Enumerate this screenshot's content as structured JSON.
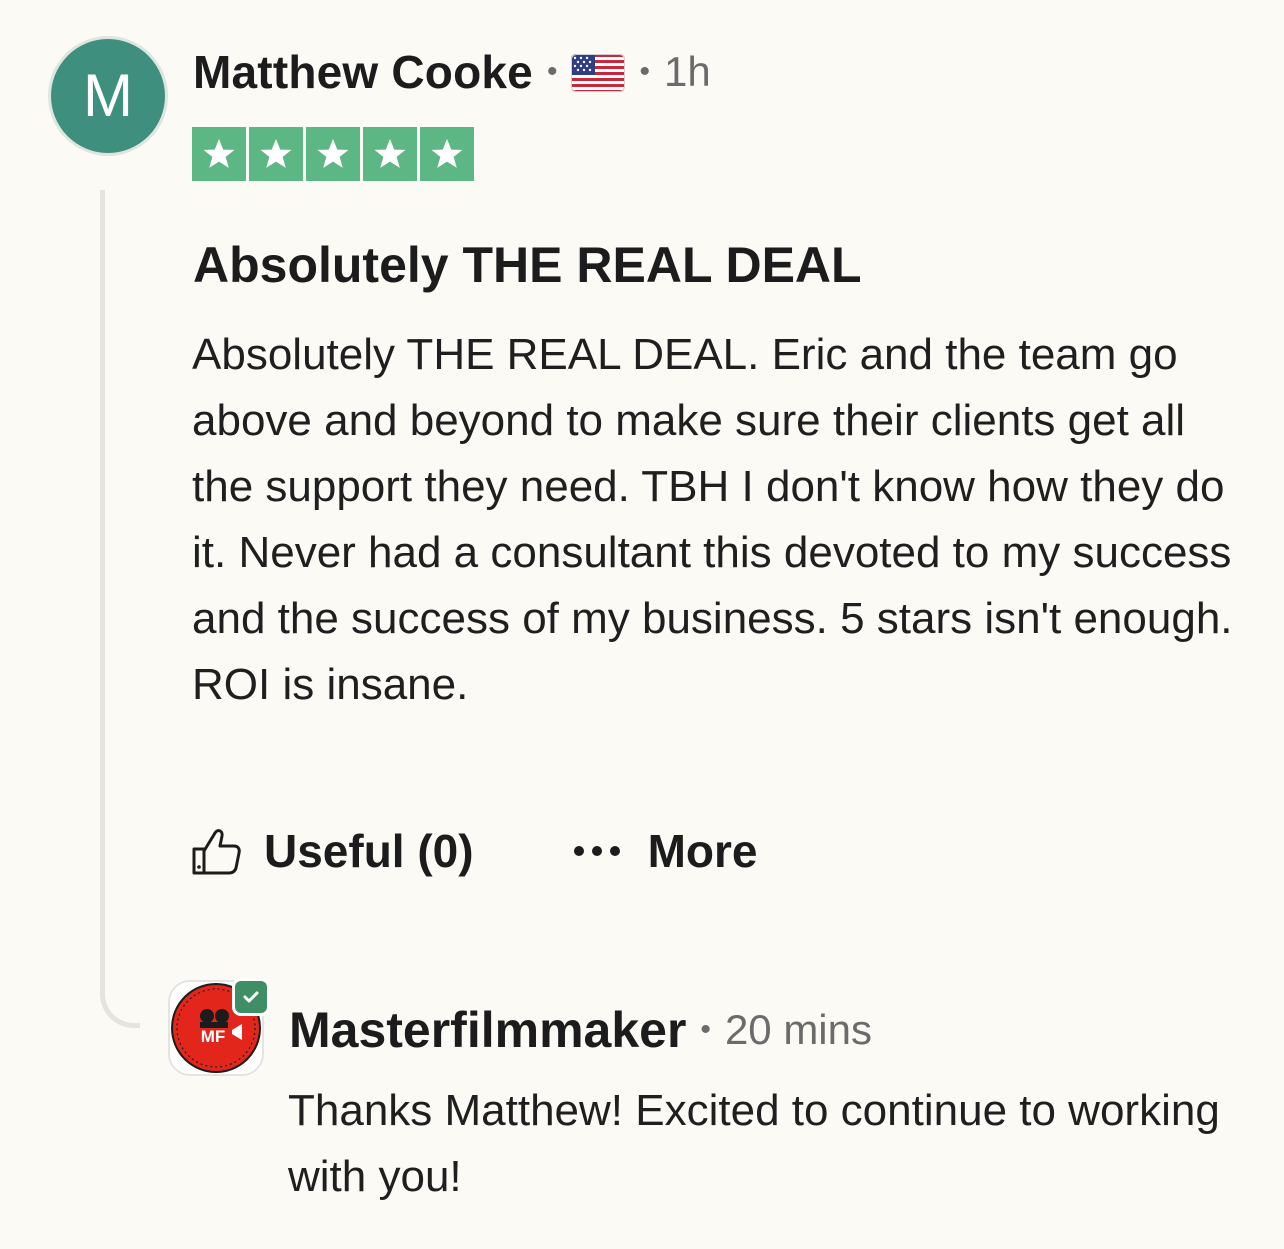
{
  "review": {
    "avatar_initial": "M",
    "reviewer_name": "Matthew Cooke",
    "separator": "•",
    "country_flag": "us-flag-icon",
    "time_ago": "1h",
    "rating": 5,
    "rating_max": 5,
    "title": "Absolutely THE REAL DEAL",
    "body": "Absolutely THE REAL DEAL. Eric and the team go above and beyond to make sure their clients get all the support they need. TBH I don't know how they do it. Never had a consultant this devoted to my success and the success of my business. 5 stars isn't enough. ROI is insane."
  },
  "actions": {
    "useful_label": "Useful (0)",
    "useful_icon": "thumbs-up-icon",
    "more_label": "More",
    "more_icon": "ellipsis-icon"
  },
  "reply": {
    "company_name": "Masterfilmmaker",
    "separator": "•",
    "time_ago": "20 mins",
    "logo_text": "MF",
    "verified_icon": "checkmark-icon",
    "body": "Thanks Matthew! Excited to continue to working with you!"
  },
  "colors": {
    "background": "#fbfaf5",
    "avatar": "#3f8f7f",
    "star_green": "#5cb784",
    "verified_green": "#3f8f66",
    "logo_red": "#e3261b",
    "muted_text": "#6b6b6b"
  }
}
